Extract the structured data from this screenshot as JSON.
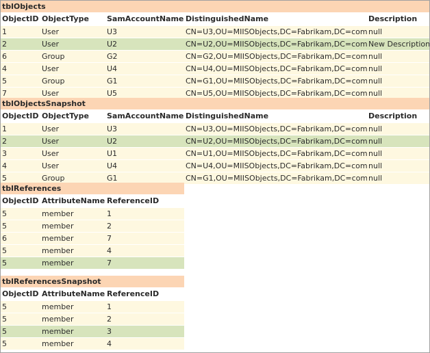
{
  "tables": {
    "objects": {
      "title": "tblObjects",
      "columns": [
        "ObjectID",
        "ObjectType",
        "SamAccountName",
        "DistinguishedName",
        "Description"
      ],
      "rows": [
        {
          "highlight": false,
          "cells": [
            "1",
            "User",
            "U3",
            "CN=U3,OU=MIISObjects,DC=Fabrikam,DC=com",
            "null"
          ]
        },
        {
          "highlight": true,
          "cells": [
            "2",
            "User",
            "U2",
            "CN=U2,OU=MIISObjects,DC=Fabrikam,DC=com",
            "New Description"
          ]
        },
        {
          "highlight": false,
          "cells": [
            "6",
            "Group",
            "G2",
            "CN=G2,OU=MIISObjects,DC=Fabrikam,DC=com",
            "null"
          ]
        },
        {
          "highlight": false,
          "cells": [
            "4",
            "User",
            "U4",
            "CN=U4,OU=MIISObjects,DC=Fabrikam,DC=com",
            "null"
          ]
        },
        {
          "highlight": false,
          "cells": [
            "5",
            "Group",
            "G1",
            "CN=G1,OU=MIISObjects,DC=Fabrikam,DC=com",
            "null"
          ]
        },
        {
          "highlight": false,
          "cells": [
            "7",
            "User",
            "U5",
            "CN=U5,OU=MIISObjects,DC=Fabrikam,DC=com",
            "null"
          ]
        }
      ]
    },
    "objects_snapshot": {
      "title": "tblObjectsSnapshot",
      "columns": [
        "ObjectID",
        "ObjectType",
        "SamAccountName",
        "DistinguishedName",
        "Description"
      ],
      "rows": [
        {
          "highlight": false,
          "cells": [
            "1",
            "User",
            "U3",
            "CN=U3,OU=MIISObjects,DC=Fabrikam,DC=com",
            "null"
          ]
        },
        {
          "highlight": true,
          "cells": [
            "2",
            "User",
            "U2",
            "CN=U2,OU=MIISObjects,DC=Fabrikam,DC=com",
            "null"
          ]
        },
        {
          "highlight": false,
          "cells": [
            "3",
            "User",
            "U1",
            "CN=U1,OU=MIISObjects,DC=Fabrikam,DC=com",
            "null"
          ]
        },
        {
          "highlight": false,
          "cells": [
            "4",
            "User",
            "U4",
            "CN=U4,OU=MIISObjects,DC=Fabrikam,DC=com",
            "null"
          ]
        },
        {
          "highlight": false,
          "cells": [
            "5",
            "Group",
            "G1",
            "CN=G1,OU=MIISObjects,DC=Fabrikam,DC=com",
            "null"
          ]
        }
      ]
    },
    "references": {
      "title": "tblReferences",
      "columns": [
        "ObjectID",
        "AttributeName",
        "ReferenceID"
      ],
      "rows": [
        {
          "highlight": false,
          "cells": [
            "5",
            "member",
            "1"
          ]
        },
        {
          "highlight": false,
          "cells": [
            "5",
            "member",
            "2"
          ]
        },
        {
          "highlight": false,
          "cells": [
            "6",
            "member",
            "7"
          ]
        },
        {
          "highlight": false,
          "cells": [
            "5",
            "member",
            "4"
          ]
        },
        {
          "highlight": true,
          "cells": [
            "5",
            "member",
            "7"
          ]
        }
      ]
    },
    "references_snapshot": {
      "title": "tblReferencesSnapshot",
      "columns": [
        "ObjectID",
        "AttributeName",
        "ReferenceID"
      ],
      "rows": [
        {
          "highlight": false,
          "cells": [
            "5",
            "member",
            "1"
          ]
        },
        {
          "highlight": false,
          "cells": [
            "5",
            "member",
            "2"
          ]
        },
        {
          "highlight": true,
          "cells": [
            "5",
            "member",
            "3"
          ]
        },
        {
          "highlight": false,
          "cells": [
            "5",
            "member",
            "4"
          ]
        }
      ]
    }
  },
  "colors": {
    "title_bar": "#fcd5b4",
    "row_default": "#fef8e0",
    "row_highlight": "#d7e4bc"
  }
}
